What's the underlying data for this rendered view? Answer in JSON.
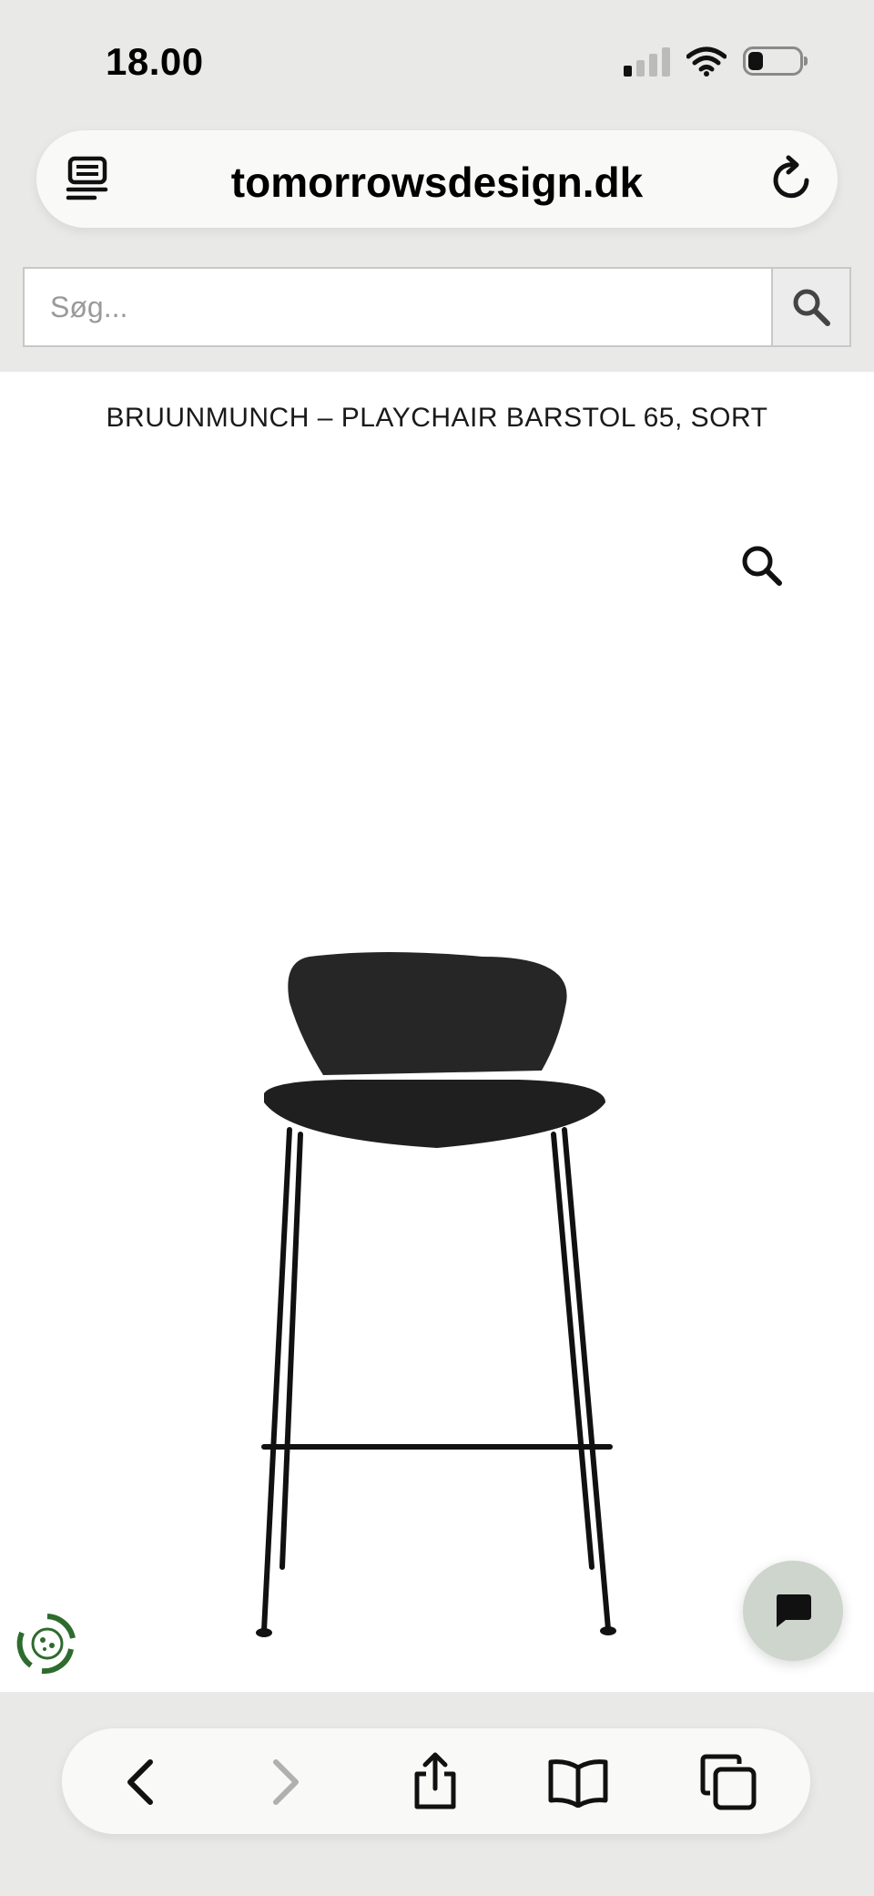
{
  "status_bar": {
    "time": "18.00",
    "icons": [
      "cellular-signal-icon",
      "wifi-icon",
      "battery-icon"
    ],
    "battery_level": 0.3
  },
  "browser": {
    "url": "tomorrowsdesign.dk",
    "left_icon": "reader-mode-icon",
    "right_icon": "reload-icon",
    "toolbar": [
      "back-icon",
      "forward-icon",
      "share-icon",
      "bookmarks-icon",
      "tabs-icon"
    ]
  },
  "search": {
    "placeholder": "Søg...",
    "value": "",
    "button_icon": "search-icon"
  },
  "product": {
    "title": "BRUUNMUNCH – PLAYCHAIR BARSTOL 65, SORT",
    "zoom_icon": "zoom-icon",
    "image": "black-bar-stool"
  },
  "widgets": {
    "cookie_icon": "cookie-consent-icon",
    "chat_icon": "chat-bubble-icon"
  },
  "colors": {
    "chrome_background": "#e9eae8",
    "chat_button": "#cdd5cc",
    "cookie_icon": "#2e6b2e"
  }
}
